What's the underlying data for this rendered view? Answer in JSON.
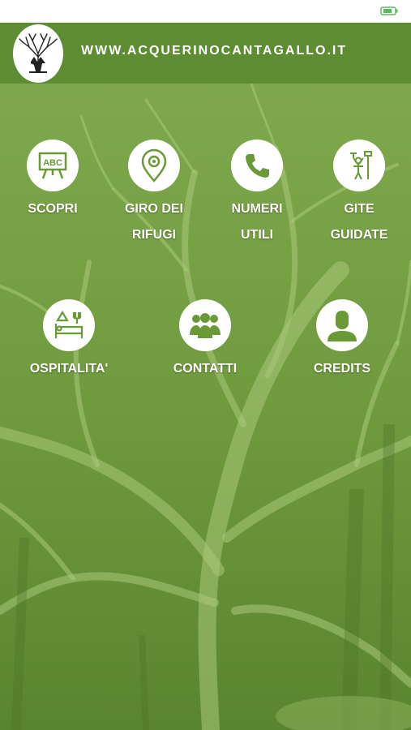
{
  "header": {
    "site_title": "WWW.ACQUERINOCANTAGALLO.IT"
  },
  "menu": [
    {
      "id": "scopri",
      "label": "SCOPRI",
      "icon": "abc-board-icon"
    },
    {
      "id": "giro-dei-rifugi",
      "label": "GIRO DEI RIFUGI",
      "icon": "map-pin-route-icon"
    },
    {
      "id": "numeri-utili",
      "label": "NUMERI UTILI",
      "icon": "phone-icon"
    },
    {
      "id": "gite-guidate",
      "label": "GITE GUIDATE",
      "icon": "hiker-guide-icon"
    },
    {
      "id": "ospitalita",
      "label": "OSPITALITA'",
      "icon": "bed-hospitality-icon"
    },
    {
      "id": "contatti",
      "label": "CONTATTI",
      "icon": "group-people-icon"
    },
    {
      "id": "credits",
      "label": "CREDITS",
      "icon": "person-silhouette-icon"
    }
  ],
  "colors": {
    "header_green": "#5d8c32",
    "background_green": "#6f9a3e",
    "icon_green": "#6a9a36",
    "text": "#ffffff"
  }
}
